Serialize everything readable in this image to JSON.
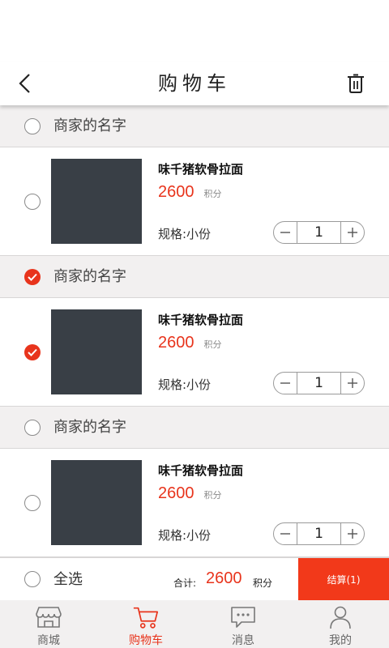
{
  "header": {
    "title": "购物车"
  },
  "colors": {
    "accent": "#e8341c",
    "thumb": "#393f46"
  },
  "groups": [
    {
      "merchant": "商家的名字",
      "checked": false,
      "item": {
        "name": "味千猪软骨拉面",
        "price": "2600",
        "unit": "积分",
        "spec": "规格:小份",
        "qty": "1",
        "checked": false
      }
    },
    {
      "merchant": "商家的名字",
      "checked": true,
      "item": {
        "name": "味千猪软骨拉面",
        "price": "2600",
        "unit": "积分",
        "spec": "规格:小份",
        "qty": "1",
        "checked": true
      }
    },
    {
      "merchant": "商家的名字",
      "checked": false,
      "item": {
        "name": "味千猪软骨拉面",
        "price": "2600",
        "unit": "积分",
        "spec": "规格:小份",
        "qty": "1",
        "checked": false
      }
    }
  ],
  "checkout": {
    "select_all": "全选",
    "total_label": "合计:",
    "total_value": "2600",
    "total_unit": "积分",
    "button": "结算(1)"
  },
  "tabs": [
    {
      "label": "商城",
      "icon": "shop-icon",
      "active": false
    },
    {
      "label": "购物车",
      "icon": "cart-icon",
      "active": true
    },
    {
      "label": "消息",
      "icon": "message-icon",
      "active": false
    },
    {
      "label": "我的",
      "icon": "user-icon",
      "active": false
    }
  ]
}
